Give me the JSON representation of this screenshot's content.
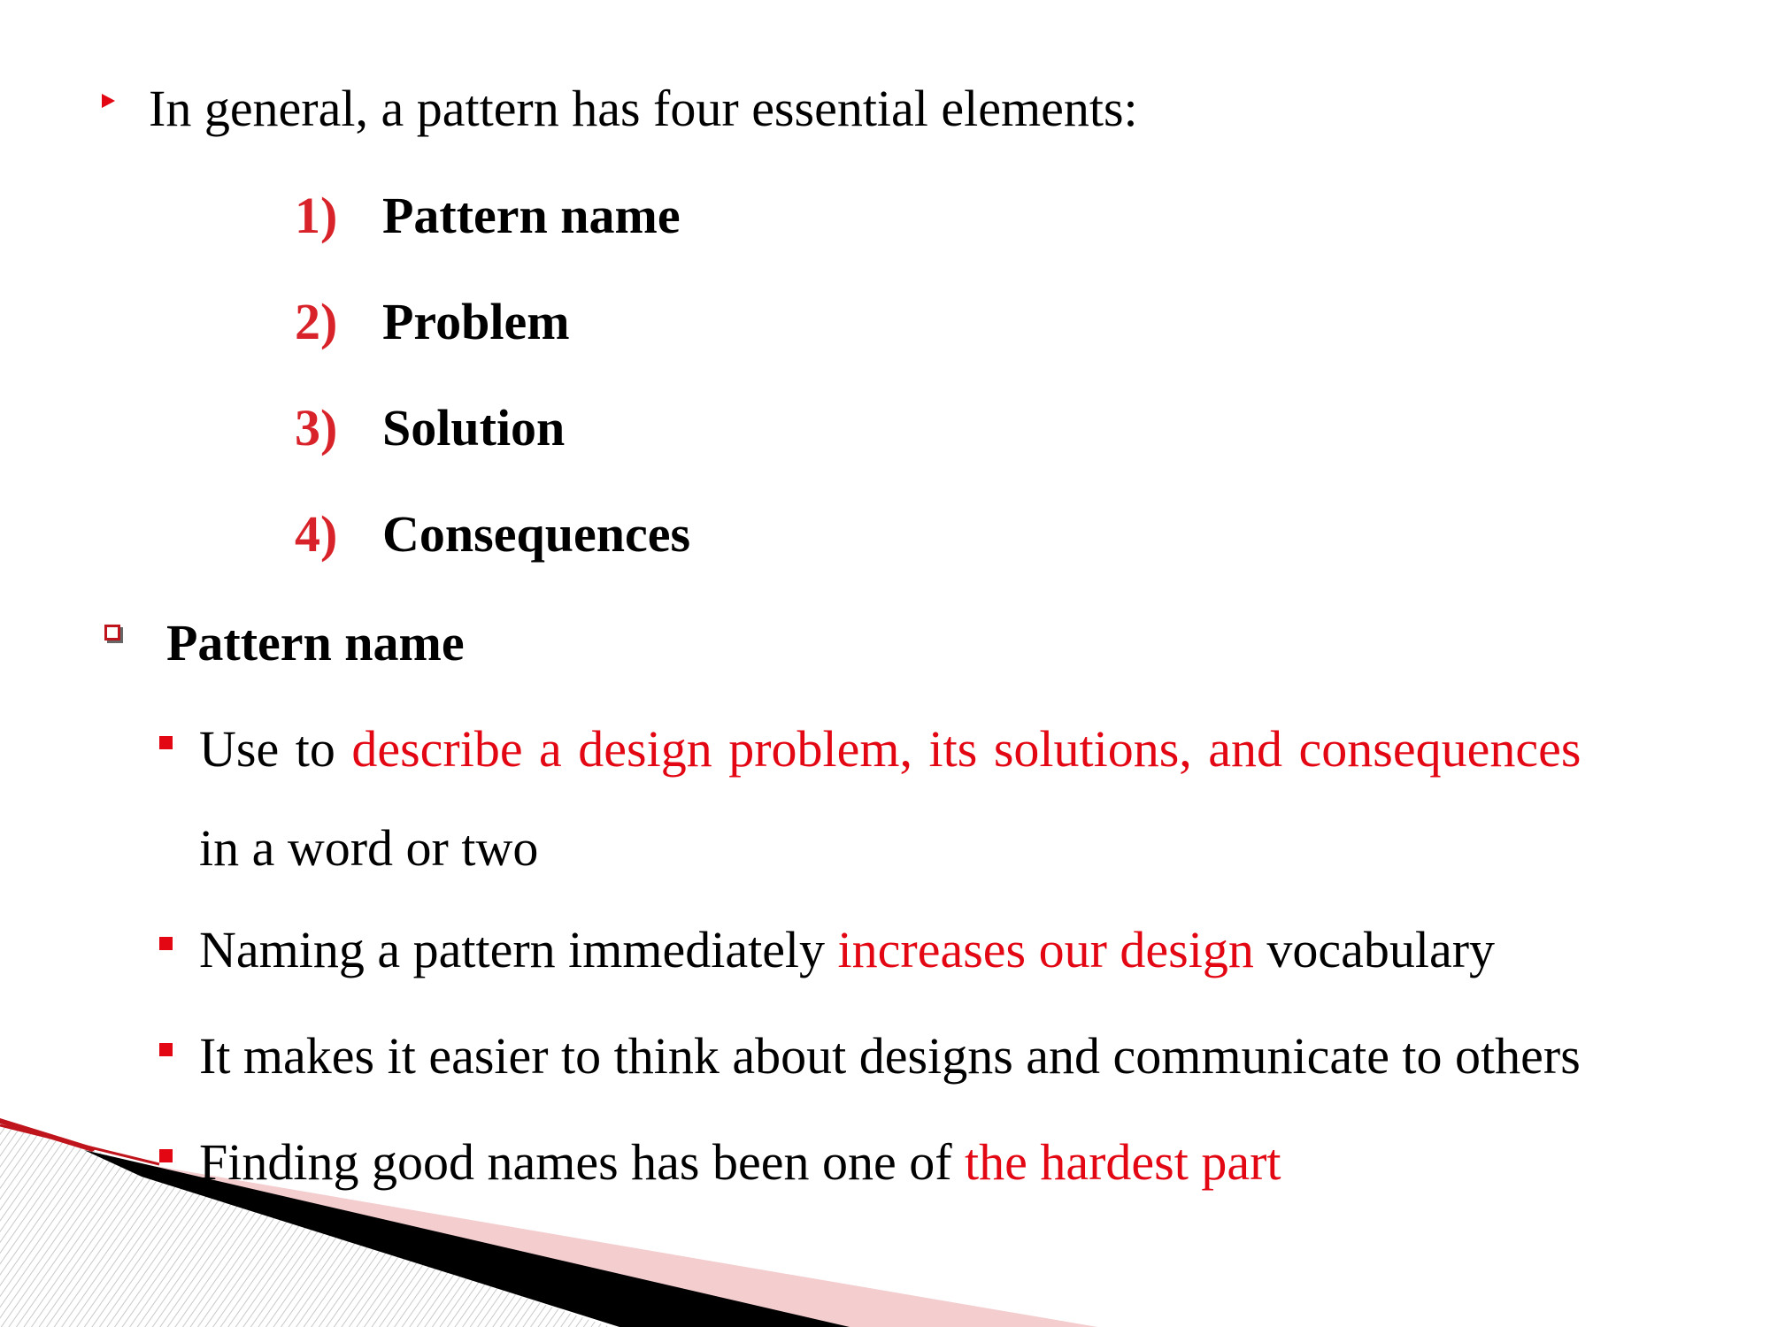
{
  "intro": {
    "text": "In general, a pattern has four essential elements:"
  },
  "elements": [
    {
      "number": "1)",
      "label": "Pattern name"
    },
    {
      "number": "2)",
      "label": "Problem"
    },
    {
      "number": "3)",
      "label": "Solution"
    },
    {
      "number": "4)",
      "label": "Consequences"
    }
  ],
  "section": {
    "heading": "Pattern name",
    "bullets": [
      {
        "line1_part1": "Use to ",
        "line1_red": "describe a design problem, its solutions, and consequences",
        "line2": "in a word or two"
      },
      {
        "part1": "Naming a pattern immediately ",
        "red": "increases our design",
        "part2": " vocabulary"
      },
      {
        "part1": "It makes it easier to think about designs and communicate to others"
      },
      {
        "part1": "Finding good names has been one of ",
        "red": "the hardest part"
      }
    ]
  },
  "colors": {
    "accent": "#e30613",
    "number": "#d9232a",
    "text": "#000000",
    "decor_pink": "#f4cdcf",
    "decor_black": "#000000"
  },
  "icons": {
    "intro_bullet": "triangle-bullet-icon",
    "section_bullet": "hollow-square-bullet-icon",
    "sub_bullet": "filled-square-bullet-icon"
  }
}
